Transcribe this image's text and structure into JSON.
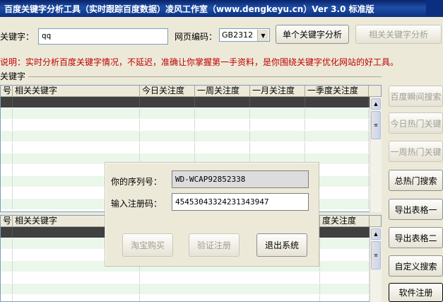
{
  "window": {
    "title": "百度关键字分析工具（实时跟踪百度数据）凌风工作室（www.dengkeyu.cn）Ver 3.0 标准版"
  },
  "form": {
    "keyword_label": "关键字：",
    "keyword_value": "qq",
    "encoding_label": "网页编码：",
    "encoding_value": "GB2312",
    "single_analysis_button": "单个关键字分析",
    "related_analysis_button": "相关关键字分析"
  },
  "description": "说明：实时分析百度关键字情况，不延迟，准确让你掌握第一手资料，是你围绕关键字优化网站的好工具。",
  "group_title": "关键字",
  "top_table": {
    "columns": [
      "号",
      "相关关键字",
      "今日关注度",
      "一周关注度",
      "一月关注度",
      "一季度关注度"
    ]
  },
  "bottom_table": {
    "columns": [
      "号",
      "相关关键字",
      "度关注度"
    ]
  },
  "side_buttons": {
    "baidu_instant": "百度瞬间搜索",
    "today_hot": "今日热门关键",
    "week_hot": "一周热门关键",
    "total_hot": "总热门搜索",
    "export_table1": "导出表格一",
    "export_table2": "导出表格二",
    "custom_search": "自定义搜索",
    "software_register": "软件注册"
  },
  "register_dialog": {
    "serial_label": "你的序列号：",
    "serial_value": "WD-WCAP92852338",
    "code_label": "输入注册码：",
    "code_value": "45453043324231343947",
    "taobao_button": "淘宝购买",
    "verify_button": "验证注册",
    "exit_button": "退出系统"
  }
}
